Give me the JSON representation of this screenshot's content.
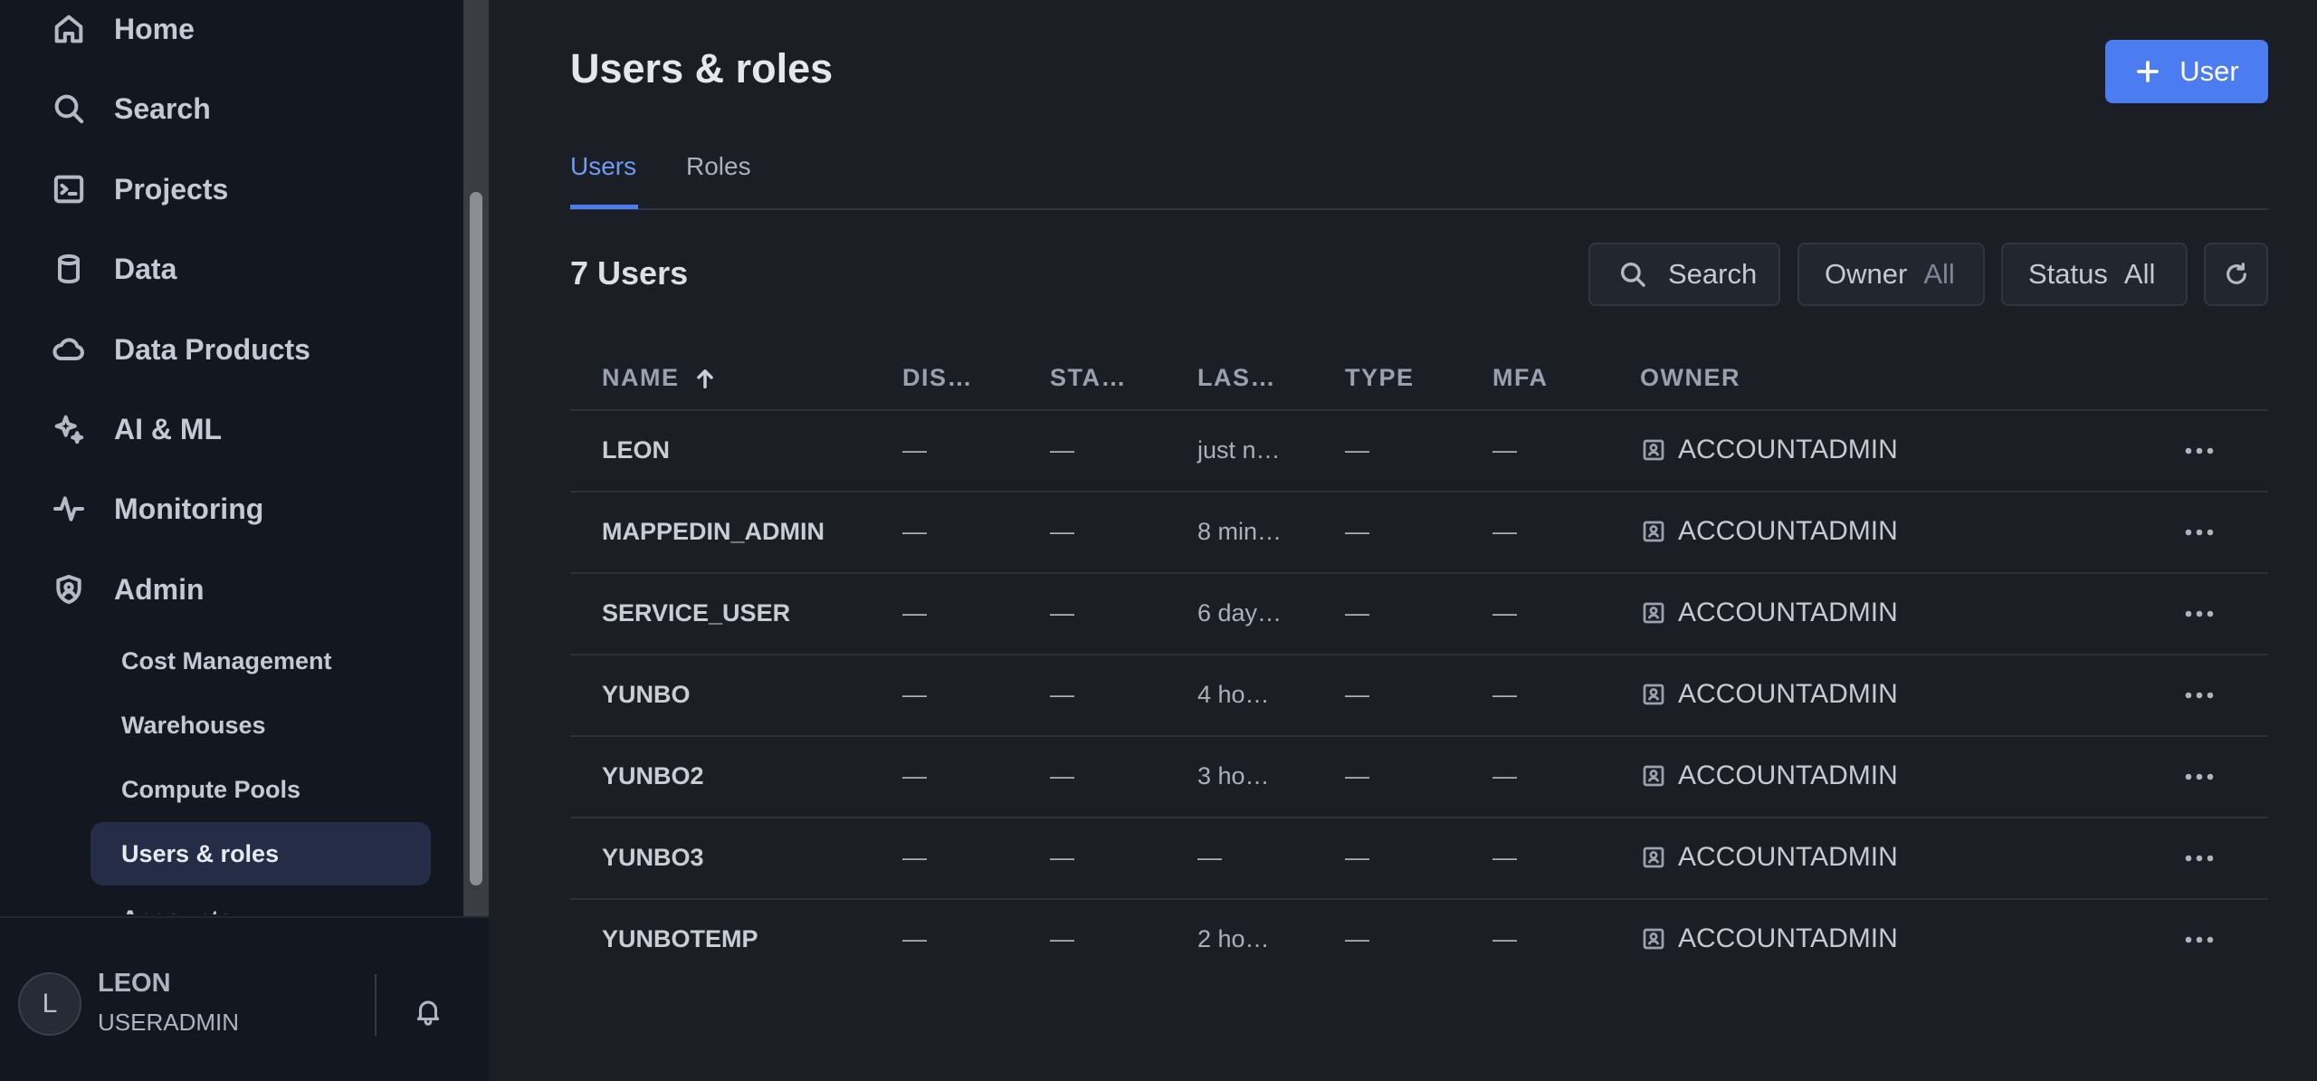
{
  "sidebar": {
    "nav": [
      {
        "label": "Home",
        "icon": "home-icon"
      },
      {
        "label": "Search",
        "icon": "search-icon"
      },
      {
        "label": "Projects",
        "icon": "terminal-icon"
      },
      {
        "label": "Data",
        "icon": "database-icon"
      },
      {
        "label": "Data Products",
        "icon": "cloud-icon"
      },
      {
        "label": "AI & ML",
        "icon": "sparkle-icon"
      },
      {
        "label": "Monitoring",
        "icon": "activity-icon"
      },
      {
        "label": "Admin",
        "icon": "shield-icon"
      }
    ],
    "admin_items": [
      "Cost Management",
      "Warehouses",
      "Compute Pools",
      "Users & roles",
      "Accounts"
    ],
    "active_item": "Users & roles"
  },
  "user": {
    "initial": "L",
    "name": "LEON",
    "role": "USERADMIN"
  },
  "page": {
    "title": "Users & roles",
    "add_button": "User",
    "tabs": [
      "Users",
      "Roles"
    ],
    "active_tab": "Users",
    "count_label": "7 Users"
  },
  "toolbar": {
    "search": "Search",
    "owner_label": "Owner",
    "owner_value": "All",
    "status_label": "Status",
    "status_value": "All"
  },
  "table": {
    "columns": [
      "NAME",
      "DIS…",
      "STA…",
      "LAS…",
      "TYPE",
      "MFA",
      "OWNER"
    ],
    "rows": [
      {
        "name": "LEON",
        "display": "—",
        "status": "—",
        "last": "just n…",
        "type": "—",
        "mfa": "—",
        "owner": "ACCOUNTADMIN"
      },
      {
        "name": "MAPPEDIN_ADMIN",
        "display": "—",
        "status": "—",
        "last": "8 min…",
        "type": "—",
        "mfa": "—",
        "owner": "ACCOUNTADMIN"
      },
      {
        "name": "SERVICE_USER",
        "display": "—",
        "status": "—",
        "last": "6 day…",
        "type": "—",
        "mfa": "—",
        "owner": "ACCOUNTADMIN"
      },
      {
        "name": "YUNBO",
        "display": "—",
        "status": "—",
        "last": "4 ho…",
        "type": "—",
        "mfa": "—",
        "owner": "ACCOUNTADMIN"
      },
      {
        "name": "YUNBO2",
        "display": "—",
        "status": "—",
        "last": "3 ho…",
        "type": "—",
        "mfa": "—",
        "owner": "ACCOUNTADMIN"
      },
      {
        "name": "YUNBO3",
        "display": "—",
        "status": "—",
        "last": "—",
        "type": "—",
        "mfa": "—",
        "owner": "ACCOUNTADMIN"
      },
      {
        "name": "YUNBOTEMP",
        "display": "—",
        "status": "—",
        "last": "2 ho…",
        "type": "—",
        "mfa": "—",
        "owner": "ACCOUNTADMIN"
      }
    ]
  },
  "colors": {
    "accent": "#4b7cf0",
    "tab_active": "#6f9bf5",
    "background": "#1b1e25",
    "sidebar": "#131720"
  }
}
